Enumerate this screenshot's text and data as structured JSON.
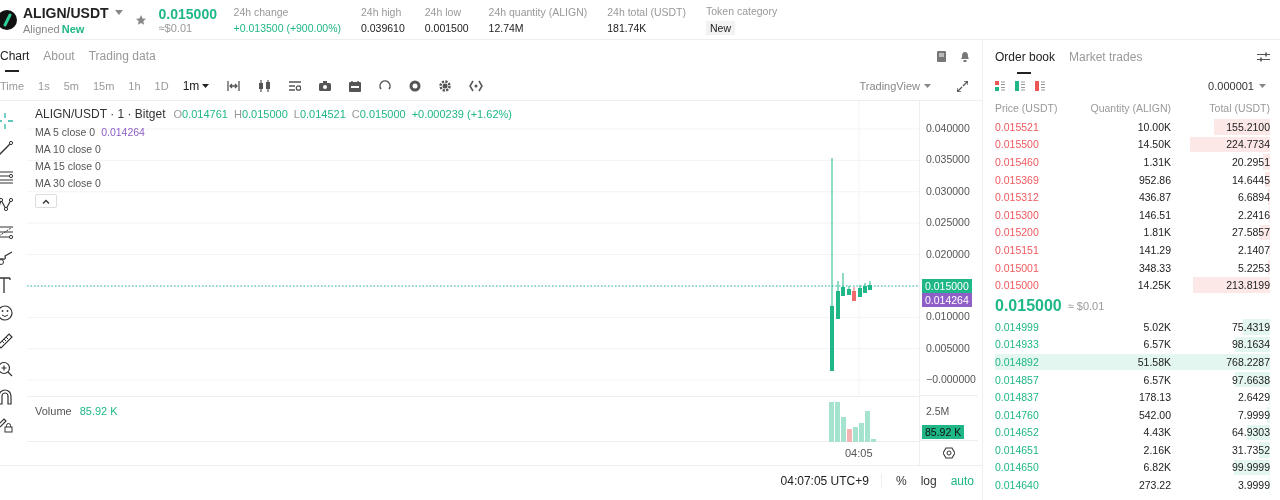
{
  "header": {
    "pair": "ALIGN/USDT",
    "subtitle": "Aligned",
    "badge": "New",
    "price": "0.015000",
    "price_usd": "≈$0.01",
    "stats": [
      {
        "label": "24h change",
        "value": "+0.013500 (+900.00%)",
        "kind": "up"
      },
      {
        "label": "24h high",
        "value": "0.039610",
        "kind": "plain"
      },
      {
        "label": "24h low",
        "value": "0.001500",
        "kind": "plain"
      },
      {
        "label": "24h quantity (ALIGN)",
        "value": "12.74M",
        "kind": "plain"
      },
      {
        "label": "24h total (USDT)",
        "value": "181.74K",
        "kind": "plain"
      }
    ],
    "category": {
      "label": "Token category",
      "tag": "New"
    }
  },
  "tabs": [
    {
      "label": "Chart",
      "selected": true
    },
    {
      "label": "About",
      "selected": false
    },
    {
      "label": "Trading data",
      "selected": false
    }
  ],
  "intervals": [
    {
      "label": "Time",
      "selected": false
    },
    {
      "label": "1s",
      "selected": false
    },
    {
      "label": "5m",
      "selected": false
    },
    {
      "label": "15m",
      "selected": false
    },
    {
      "label": "1h",
      "selected": false
    },
    {
      "label": "1D",
      "selected": false
    },
    {
      "label": "1m",
      "selected": true
    }
  ],
  "chart_source": "TradingView",
  "legend": {
    "title": "ALIGN/USDT · 1 · Bitget",
    "ohlc": [
      {
        "label": "O",
        "value": "0.014761"
      },
      {
        "label": "H",
        "value": "0.015000"
      },
      {
        "label": "L",
        "value": "0.014521"
      },
      {
        "label": "C",
        "value": "0.015000"
      }
    ],
    "change": "+0.000239 (+1.62%)",
    "ma": [
      {
        "label": "MA 5 close 0",
        "value": "0.014264"
      },
      {
        "label": "MA 10 close 0"
      },
      {
        "label": "MA 15 close 0"
      },
      {
        "label": "MA 30 close 0"
      }
    ]
  },
  "price_axis": [
    "0.040000",
    "0.035000",
    "0.030000",
    "0.025000",
    "0.020000",
    "0.010000",
    "0.005000",
    "−0.000000"
  ],
  "last_price_tag": "0.015000",
  "ma_tag": "0.014264",
  "volume": {
    "label": "Volume",
    "value": "85.92 K",
    "axis": "2.5M",
    "tag": "85.92 K"
  },
  "time_axis": "04:05",
  "footer": {
    "clock": "04:07:05 UTC+9",
    "scales": [
      {
        "label": "%",
        "selected": false
      },
      {
        "label": "log",
        "selected": false
      },
      {
        "label": "auto",
        "selected": true
      }
    ]
  },
  "order_book": {
    "tabs": [
      {
        "label": "Order book",
        "selected": true
      },
      {
        "label": "Market trades",
        "selected": false
      }
    ],
    "step": "0.000001",
    "columns": [
      "Price (USDT)",
      "Quantity (ALIGN)",
      "Total (USDT)"
    ],
    "asks": [
      {
        "price": "0.015521",
        "quantity": "10.00K",
        "total": "155.2100"
      },
      {
        "price": "0.015500",
        "quantity": "14.50K",
        "total": "224.7734"
      },
      {
        "price": "0.015460",
        "quantity": "1.31K",
        "total": "20.2951"
      },
      {
        "price": "0.015369",
        "quantity": "952.86",
        "total": "14.6445"
      },
      {
        "price": "0.015312",
        "quantity": "436.87",
        "total": "6.6894"
      },
      {
        "price": "0.015300",
        "quantity": "146.51",
        "total": "2.2416"
      },
      {
        "price": "0.015200",
        "quantity": "1.81K",
        "total": "27.5857"
      },
      {
        "price": "0.015151",
        "quantity": "141.29",
        "total": "2.1407"
      },
      {
        "price": "0.015001",
        "quantity": "348.33",
        "total": "5.2253"
      },
      {
        "price": "0.015000",
        "quantity": "14.25K",
        "total": "213.8199"
      }
    ],
    "mid_price": "0.015000",
    "mid_usd": "≈ $0.01",
    "bids": [
      {
        "price": "0.014999",
        "quantity": "5.02K",
        "total": "75.4319"
      },
      {
        "price": "0.014933",
        "quantity": "6.57K",
        "total": "98.1634"
      },
      {
        "price": "0.014892",
        "quantity": "51.58K",
        "total": "768.2287"
      },
      {
        "price": "0.014857",
        "quantity": "6.57K",
        "total": "97.6638"
      },
      {
        "price": "0.014837",
        "quantity": "178.13",
        "total": "2.6429"
      },
      {
        "price": "0.014760",
        "quantity": "542.00",
        "total": "7.9999"
      },
      {
        "price": "0.014652",
        "quantity": "4.43K",
        "total": "64.9303"
      },
      {
        "price": "0.014651",
        "quantity": "2.16K",
        "total": "31.7352"
      },
      {
        "price": "0.014650",
        "quantity": "6.82K",
        "total": "99.9999"
      },
      {
        "price": "0.014640",
        "quantity": "273.22",
        "total": "3.9999"
      }
    ]
  }
}
